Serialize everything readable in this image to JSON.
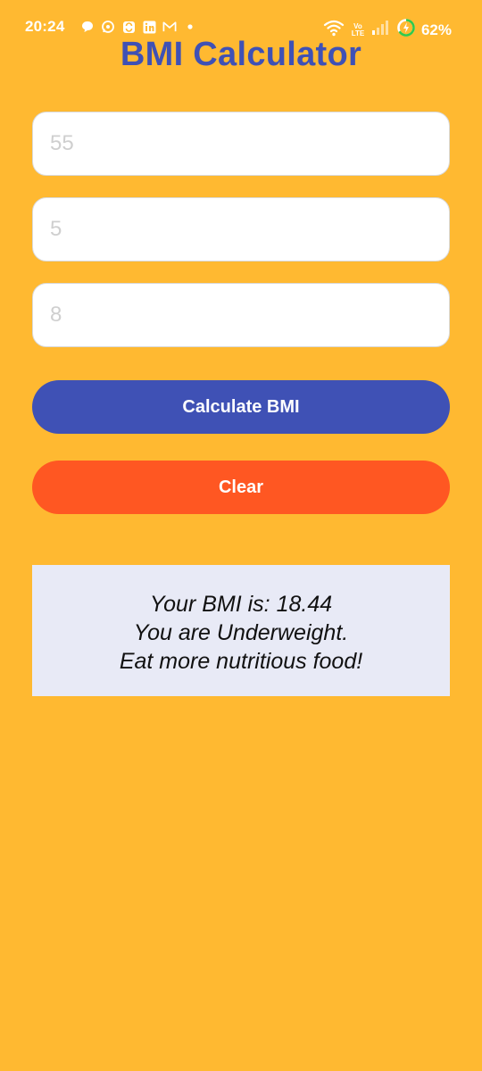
{
  "status_bar": {
    "time": "20:24",
    "network_label_top": "Vo",
    "network_label_bottom": "LTE",
    "battery": "62%",
    "icons": [
      "chat-bubble-icon",
      "whatsapp-icon",
      "sync-app-icon",
      "linkedin-icon",
      "gmail-icon",
      "dot-icon",
      "wifi-icon",
      "signal-icon",
      "battery-charging-icon"
    ]
  },
  "app": {
    "title": "BMI Calculator"
  },
  "form": {
    "weight_placeholder": "55",
    "height_feet_placeholder": "5",
    "height_inches_placeholder": "8",
    "calculate_label": "Calculate BMI",
    "clear_label": "Clear"
  },
  "result": {
    "line1": "Your BMI is: 18.44",
    "line2": "You are Underweight.",
    "line3": "Eat more nutritious food!"
  },
  "colors": {
    "background": "#FFB931",
    "primary": "#3F51B5",
    "accent": "#FF5722",
    "result_bg": "#E8EAF6"
  }
}
